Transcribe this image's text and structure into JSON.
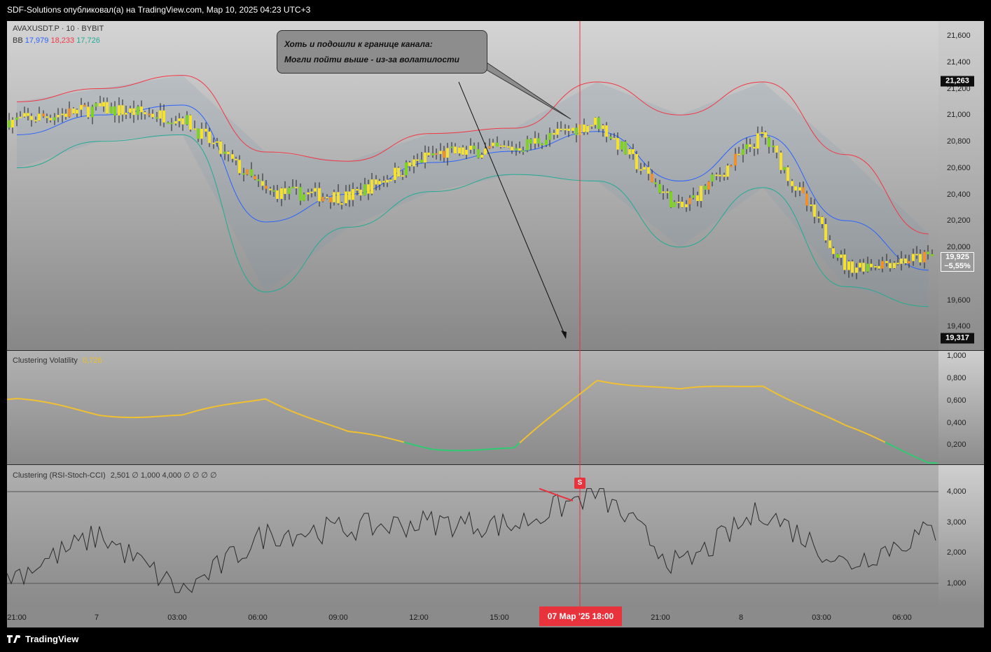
{
  "header": {
    "text": "SDF-Solutions опубликовал(а) на TradingView.com, Мар 10, 2025 04:23 UTC+3"
  },
  "main": {
    "symbol": "AVAXUSDT.P · 10 · BYBIT",
    "bb_label": "BB",
    "bb_basis": "17,979",
    "bb_upper": "18,233",
    "bb_lower": "17,726",
    "colors": {
      "basis": "#2962ff",
      "upper": "#f23645",
      "lower": "#22ab94"
    }
  },
  "note": {
    "line1": "Хоть и подошли к границе канала:",
    "line2": "Могли пойти выше - из-за волатилости"
  },
  "price_axis": {
    "ticks": [
      "21,600",
      "21,400",
      "21,200",
      "21,000",
      "20,800",
      "20,600",
      "20,400",
      "20,200",
      "20,000",
      "19,600",
      "19,400"
    ],
    "high_marker": "21,263",
    "low_marker": "19,317",
    "current_price": "19,925",
    "current_change": "−5,55%"
  },
  "volatility": {
    "title": "Clustering Volatility",
    "value": "0,726",
    "ticks": [
      "1,000",
      "0,800",
      "0,600",
      "0,400",
      "0,200"
    ]
  },
  "clustering": {
    "title": "Clustering (RSI-Stoch-CCI)",
    "params": "2,501  ∅  1,000  4,000  ∅  ∅  ∅  ∅",
    "ticks": [
      "4,000",
      "3,000",
      "2,000",
      "1,000"
    ],
    "signal": "S"
  },
  "time_axis": {
    "ticks": [
      "21:00",
      "7",
      "03:00",
      "06:00",
      "09:00",
      "12:00",
      "15:00",
      "21:00",
      "8",
      "03:00",
      "06:00"
    ],
    "cursor_label": "07 Мар '25   18:00"
  },
  "footer": {
    "brand": "TradingView"
  },
  "chart_data": [
    {
      "type": "candlestick",
      "symbol": "AVAXUSDT.P",
      "timeframe": "10",
      "exchange": "BYBIT",
      "x": [
        "06 21:00",
        "07 00:00",
        "07 03:00",
        "07 06:00",
        "07 09:00",
        "07 12:00",
        "07 15:00",
        "07 18:00",
        "07 21:00",
        "08 00:00",
        "08 03:00",
        "08 06:00"
      ],
      "close": [
        20960,
        21050,
        20980,
        20420,
        20380,
        20700,
        20750,
        20950,
        20280,
        20850,
        19850,
        19925
      ],
      "bb_upper": [
        21100,
        21200,
        21300,
        20720,
        20650,
        20860,
        20900,
        21250,
        21000,
        21250,
        20700,
        20100
      ],
      "bb_lower": [
        20600,
        20800,
        20850,
        19660,
        20150,
        20420,
        20550,
        20500,
        20000,
        20450,
        19700,
        19550
      ],
      "ylim": [
        19300,
        21700
      ]
    },
    {
      "type": "line",
      "title": "Clustering Volatility",
      "x": [
        "06 21:00",
        "07 00:00",
        "07 03:00",
        "07 06:00",
        "07 09:00",
        "07 12:00",
        "07 15:00",
        "07 18:00",
        "07 21:00",
        "08 00:00",
        "08 03:00",
        "08 06:00"
      ],
      "y": [
        0.6,
        0.48,
        0.45,
        0.63,
        0.3,
        0.18,
        0.15,
        0.8,
        0.68,
        0.75,
        0.35,
        0.06
      ],
      "ylim": [
        0,
        1.05
      ]
    },
    {
      "type": "line",
      "title": "Clustering (RSI-Stoch-CCI)",
      "x": [
        "06 21:00",
        "07 00:00",
        "07 03:00",
        "07 06:00",
        "07 09:00",
        "07 12:00",
        "07 15:00",
        "07 18:00",
        "07 21:00",
        "08 00:00",
        "08 03:00",
        "08 06:00"
      ],
      "y": [
        1.3,
        2.6,
        0.7,
        2.6,
        2.8,
        3.0,
        2.9,
        4.0,
        1.5,
        3.4,
        1.6,
        2.7
      ],
      "levels": [
        4,
        1
      ],
      "ylim": [
        0.2,
        4.3
      ]
    }
  ]
}
